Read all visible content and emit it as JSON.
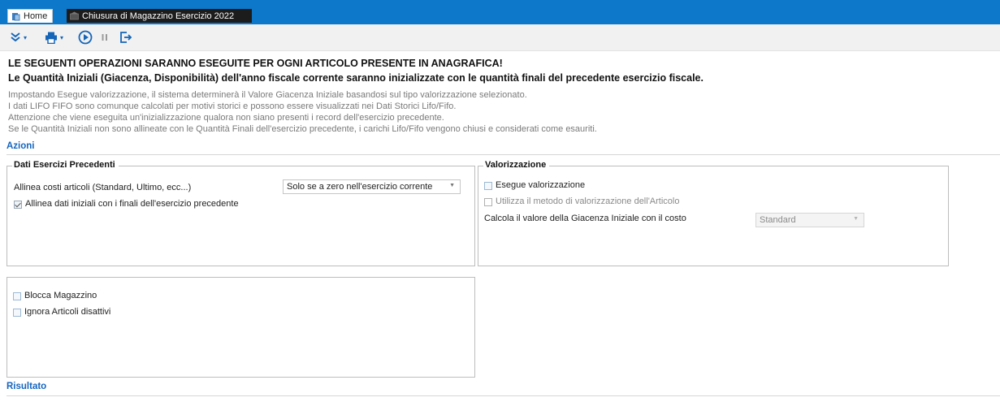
{
  "tabs": [
    {
      "label": "Home",
      "icon": "home-document-icon"
    },
    {
      "label": "Chiusura di Magazzino Esercizio 2022",
      "icon": "warehouse-icon"
    }
  ],
  "toolbar": {
    "icons": [
      "expand-chevrons-icon",
      "print-icon",
      "run-play-icon",
      "pause-icon",
      "exit-icon"
    ],
    "accent_color": "#1565b8"
  },
  "header": {
    "line1": "LE SEGUENTI OPERAZIONI SARANNO ESEGUITE PER OGNI ARTICOLO PRESENTE IN ANAGRAFICA!",
    "line2": "Le Quantità Iniziali (Giacenza, Disponibilità) dell'anno fiscale corrente saranno inizializzate con le quantità finali del precedente esercizio fiscale."
  },
  "info": [
    "Impostando Esegue valorizzazione, il sistema determinerà il Valore Giacenza Iniziale basandosi sul tipo valorizzazione selezionato.",
    "I dati LIFO FIFO sono comunque calcolati per motivi storici e possono essere visualizzati nei Dati Storici Lifo/Fifo.",
    "Attenzione che viene eseguita un'inizializzazione qualora non siano presenti i record dell'esercizio precedente.",
    "Se le Quantità Iniziali non sono allineate con le Quantità Finali dell'esercizio precedente, i carichi Lifo/Fifo vengono chiusi e considerati come esauriti."
  ],
  "sections": {
    "azioni": "Azioni",
    "risultato": "Risultato"
  },
  "dati_esercizi": {
    "title": "Dati Esercizi Precedenti",
    "allinea_costi_label": "Allinea costi articoli (Standard, Ultimo, ecc...)",
    "allinea_costi_value": "Solo se a zero nell'esercizio corrente",
    "allinea_dati_label": "Allinea dati iniziali con i finali dell'esercizio precedente",
    "allinea_dati_checked": true
  },
  "valorizzazione": {
    "title": "Valorizzazione",
    "esegue_label": "Esegue valorizzazione",
    "esegue_checked": false,
    "utilizza_label": "Utilizza il metodo di valorizzazione dell'Articolo",
    "utilizza_checked": false,
    "calcola_label": "Calcola il valore della Giacenza Iniziale con il costo",
    "calcola_value": "Standard"
  },
  "options": {
    "blocca_label": "Blocca Magazzino",
    "blocca_checked": false,
    "ignora_label": "Ignora Articoli disattivi",
    "ignora_checked": false
  }
}
